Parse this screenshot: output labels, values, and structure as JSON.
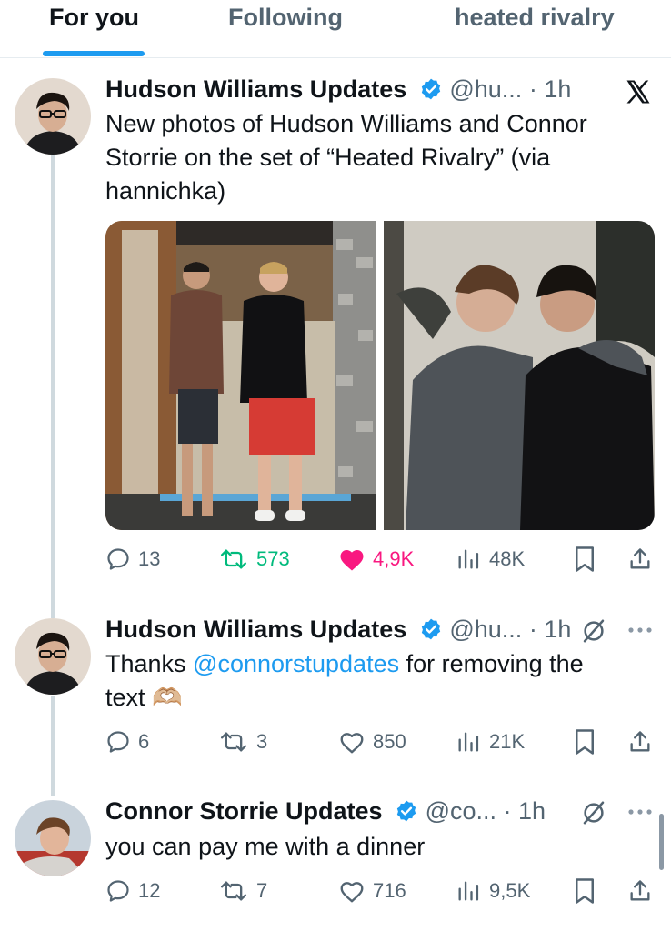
{
  "tabs": {
    "for_you": "For you",
    "following": "Following",
    "heated_rivalry": "heated rivalry"
  },
  "tweets": [
    {
      "name": "Hudson Williams Updates",
      "handle": "@hu...",
      "dot": "·",
      "time": "1h",
      "text_line1": "New photos of Hudson Williams and Connor",
      "text_line2": "Storrie on the set of “Heated Rivalry” (via",
      "text_line3": "hannichka)",
      "replies": "13",
      "retweets": "573",
      "likes": "4,9K",
      "views": "48K",
      "corner_icon": "x-logo-icon"
    },
    {
      "name": "Hudson Williams Updates",
      "handle": "@hu...",
      "dot": "·",
      "time": "1h",
      "text_before": "Thanks ",
      "mention": "@connorstupdates",
      "text_after": " for removing the",
      "text_line2": "text 🫶🏼",
      "replies": "6",
      "retweets": "3",
      "likes": "850",
      "views": "21K"
    },
    {
      "name": "Connor Storrie Updates",
      "handle": "@co...",
      "dot": "·",
      "time": "1h",
      "text_line1": "you can pay me with a dinner",
      "replies": "12",
      "retweets": "7",
      "likes": "716",
      "views": "9,5K"
    }
  ],
  "colors": {
    "accent": "#1d9bf0",
    "retweet": "#00ba7c",
    "like": "#f91880",
    "muted": "#536471"
  }
}
